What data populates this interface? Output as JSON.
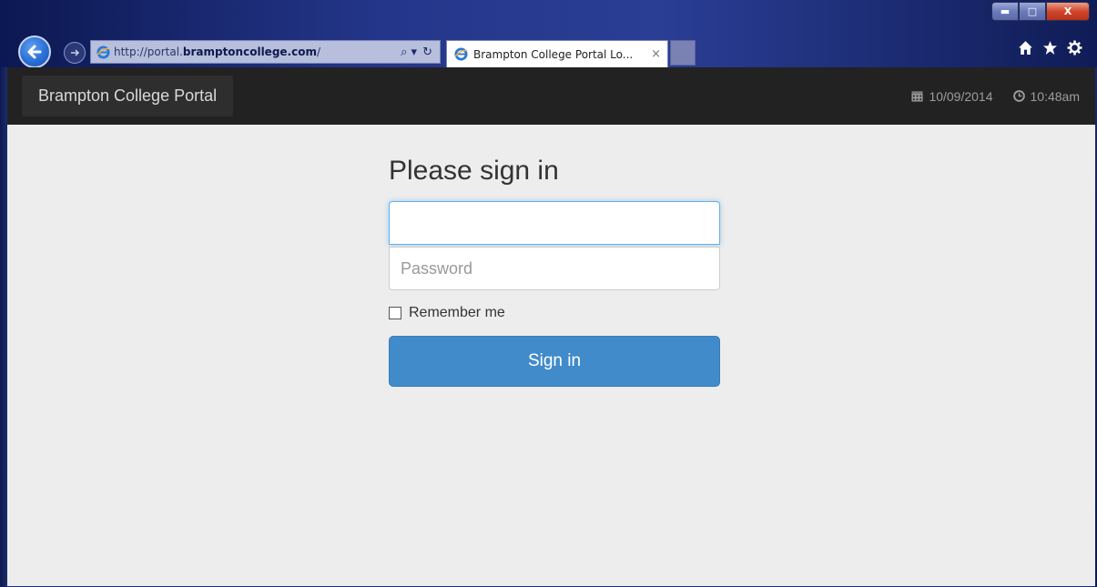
{
  "browser": {
    "address": {
      "url_prefix": "http://portal.",
      "url_host": "bramptoncollege.com",
      "url_suffix": "/",
      "search_glyph": "⌕ ▾",
      "refresh_glyph": "↻"
    },
    "tab": {
      "title": "Brampton College Portal Lo...",
      "close": "×"
    },
    "window_controls": {
      "minimize": "▬",
      "maximize": "□",
      "close": "X"
    },
    "icons": [
      "home-icon",
      "star-icon",
      "gear-icon"
    ],
    "accent_color": "#1c2b6e"
  },
  "navbar": {
    "brand": "Brampton College Portal",
    "date": "10/09/2014",
    "time": "10:48am"
  },
  "form": {
    "heading": "Please sign in",
    "username": {
      "value": "",
      "placeholder": ""
    },
    "password": {
      "value": "",
      "placeholder": "Password"
    },
    "remember_label": "Remember me",
    "remember_checked": false,
    "submit_label": "Sign in",
    "submit_color": "#428bca"
  }
}
